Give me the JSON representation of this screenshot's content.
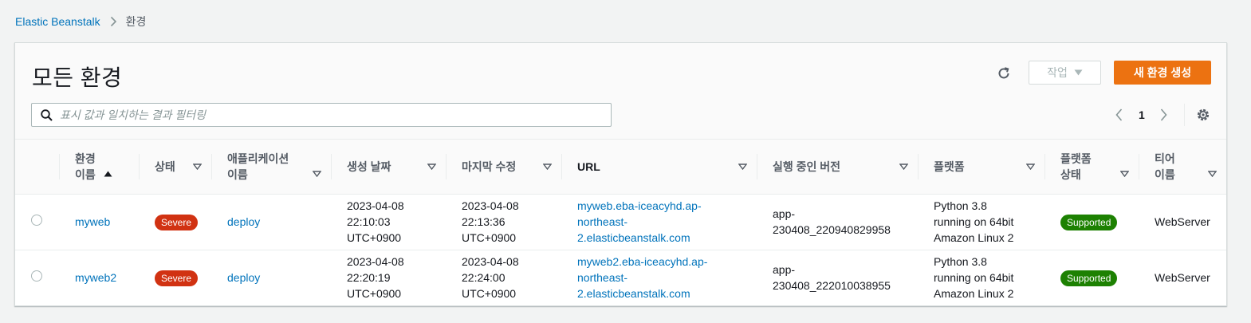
{
  "breadcrumb": {
    "root": "Elastic Beanstalk",
    "current": "환경"
  },
  "panel": {
    "title": "모든 환경",
    "actions_label": "작업",
    "create_label": "새 환경 생성",
    "search_placeholder": "표시 값과 일치하는 결과 필터링",
    "page_number": "1"
  },
  "columns": {
    "env_name_1": "환경",
    "env_name_2": "이름",
    "status": "상태",
    "app_name_1": "애플리케이션",
    "app_name_2": "이름",
    "created": "생성 날짜",
    "modified": "마지막 수정",
    "url": "URL",
    "version": "실행 중인 버전",
    "platform": "플랫폼",
    "platform_status_1": "플랫폼",
    "platform_status_2": "상태",
    "tier_1": "티어",
    "tier_2": "이름"
  },
  "rows": [
    {
      "name": "myweb",
      "status": "Severe",
      "app": "deploy",
      "created_1": "2023-04-08",
      "created_2": "22:10:03",
      "created_3": "UTC+0900",
      "modified_1": "2023-04-08",
      "modified_2": "22:13:36",
      "modified_3": "UTC+0900",
      "url_1": "myweb.eba-iceacyhd.ap-",
      "url_2": "northeast-",
      "url_3": "2.elasticbeanstalk.com",
      "version_1": "app-",
      "version_2": "230408_220940829958",
      "platform_1": "Python 3.8",
      "platform_2": "running on 64bit",
      "platform_3": "Amazon Linux 2",
      "platform_status": "Supported",
      "tier": "WebServer"
    },
    {
      "name": "myweb2",
      "status": "Severe",
      "app": "deploy",
      "created_1": "2023-04-08",
      "created_2": "22:20:19",
      "created_3": "UTC+0900",
      "modified_1": "2023-04-08",
      "modified_2": "22:24:00",
      "modified_3": "UTC+0900",
      "url_1": "myweb2.eba-iceacyhd.ap-",
      "url_2": "northeast-",
      "url_3": "2.elasticbeanstalk.com",
      "version_1": "app-",
      "version_2": "230408_222010038955",
      "platform_1": "Python 3.8",
      "platform_2": "running on 64bit",
      "platform_3": "Amazon Linux 2",
      "platform_status": "Supported",
      "tier": "WebServer"
    }
  ],
  "colors": {
    "link": "#0073bb",
    "primary": "#ec7211",
    "severe": "#d13212",
    "supported": "#1d8102"
  }
}
